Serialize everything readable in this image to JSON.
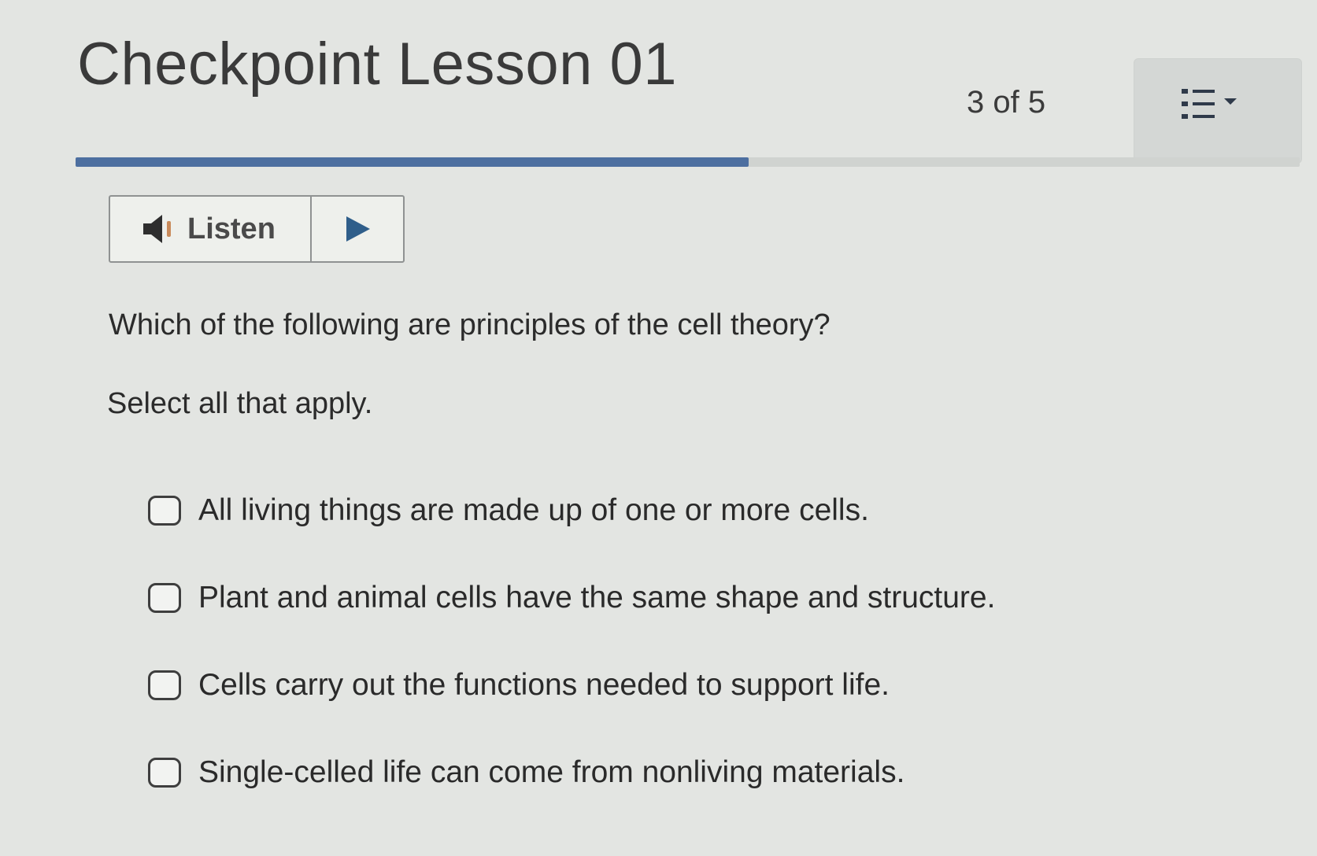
{
  "header": {
    "title": "Checkpoint Lesson 01",
    "progress_text": "3 of 5",
    "progress_fraction": 0.55,
    "menu_icon": "list-icon",
    "accent_color": "#4d6fa0"
  },
  "listen": {
    "label": "Listen",
    "speaker_icon": "speaker-icon",
    "play_icon": "play-icon"
  },
  "question": {
    "prompt": "Which of the following are principles of the cell theory?",
    "instruction": "Select all that apply.",
    "options": [
      {
        "label": "All living things are made up of one or more cells.",
        "checked": false
      },
      {
        "label": "Plant and animal cells have the same shape and structure.",
        "checked": false
      },
      {
        "label": "Cells carry out the functions needed to support life.",
        "checked": false
      },
      {
        "label": "Single-celled life can come from nonliving materials.",
        "checked": false
      }
    ]
  }
}
